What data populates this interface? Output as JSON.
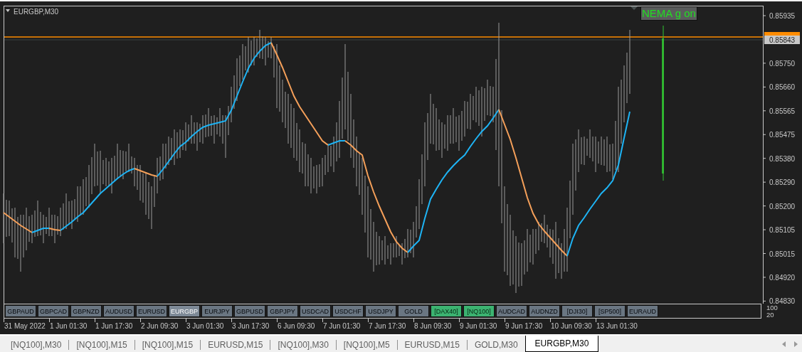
{
  "chart": {
    "title": "EURGBP,M30",
    "indicator_label": {
      "text": "NEMA g on"
    },
    "price_axis": [
      "0.85935",
      "0.85750",
      "0.85660",
      "0.85565",
      "0.85475",
      "0.85380",
      "0.85290",
      "0.85200",
      "0.85105",
      "0.85015",
      "0.84920",
      "0.84830"
    ],
    "current_price": "0.85843",
    "time_axis": [
      "31 May 2022",
      "1 Jun 01:30",
      "1 Jun 17:30",
      "2 Jun 09:30",
      "3 Jun 01:30",
      "3 Jun 17:30",
      "6 Jun 09:30",
      "7 Jun 01:30",
      "7 Jun 17:30",
      "8 Jun 09:30",
      "9 Jun 01:30",
      "9 Jun 17:30",
      "10 Jun 09:30",
      "13 Jun 01:30"
    ]
  },
  "symbol_buttons": [
    {
      "label": "GBPAUD",
      "selected": false,
      "highlighted": false
    },
    {
      "label": "GBPCAD",
      "selected": false,
      "highlighted": false
    },
    {
      "label": "GBPNZD",
      "selected": false,
      "highlighted": false
    },
    {
      "label": "AUDUSD",
      "selected": false,
      "highlighted": false
    },
    {
      "label": "EURUSD",
      "selected": false,
      "highlighted": false
    },
    {
      "label": "EURGBP",
      "selected": true,
      "highlighted": false
    },
    {
      "label": "EURJPY",
      "selected": false,
      "highlighted": false
    },
    {
      "label": "GBPUSD",
      "selected": false,
      "highlighted": false
    },
    {
      "label": "GBPJPY",
      "selected": false,
      "highlighted": false
    },
    {
      "label": "USDCAD",
      "selected": false,
      "highlighted": false
    },
    {
      "label": "USDCHF",
      "selected": false,
      "highlighted": false
    },
    {
      "label": "USDJPY",
      "selected": false,
      "highlighted": false
    },
    {
      "label": "GOLD",
      "selected": false,
      "highlighted": false
    },
    {
      "label": "[DAX40]",
      "selected": false,
      "highlighted": true
    },
    {
      "label": "[NQ100]",
      "selected": false,
      "highlighted": true
    },
    {
      "label": "AUDCAD",
      "selected": false,
      "highlighted": false
    },
    {
      "label": "AUDNZD",
      "selected": false,
      "highlighted": false
    },
    {
      "label": "[DJI30]",
      "selected": false,
      "highlighted": false
    },
    {
      "label": "[SP500]",
      "selected": false,
      "highlighted": false
    },
    {
      "label": "EURAUD",
      "selected": false,
      "highlighted": false
    }
  ],
  "subwindow_scale": [
    "100",
    "20"
  ],
  "tabs": [
    {
      "label": "[NQ100],M30",
      "selected": false
    },
    {
      "label": "[NQ100],M15",
      "selected": false
    },
    {
      "label": "[NQ100],M15",
      "selected": false
    },
    {
      "label": "EURUSD,M15",
      "selected": false
    },
    {
      "label": "[NQ100],M30",
      "selected": false
    },
    {
      "label": "[NQ100],M5",
      "selected": false
    },
    {
      "label": "EURUSD,M15",
      "selected": false
    },
    {
      "label": "GOLD,M30",
      "selected": false
    },
    {
      "label": "EURGBP,M30",
      "selected": true
    }
  ]
}
